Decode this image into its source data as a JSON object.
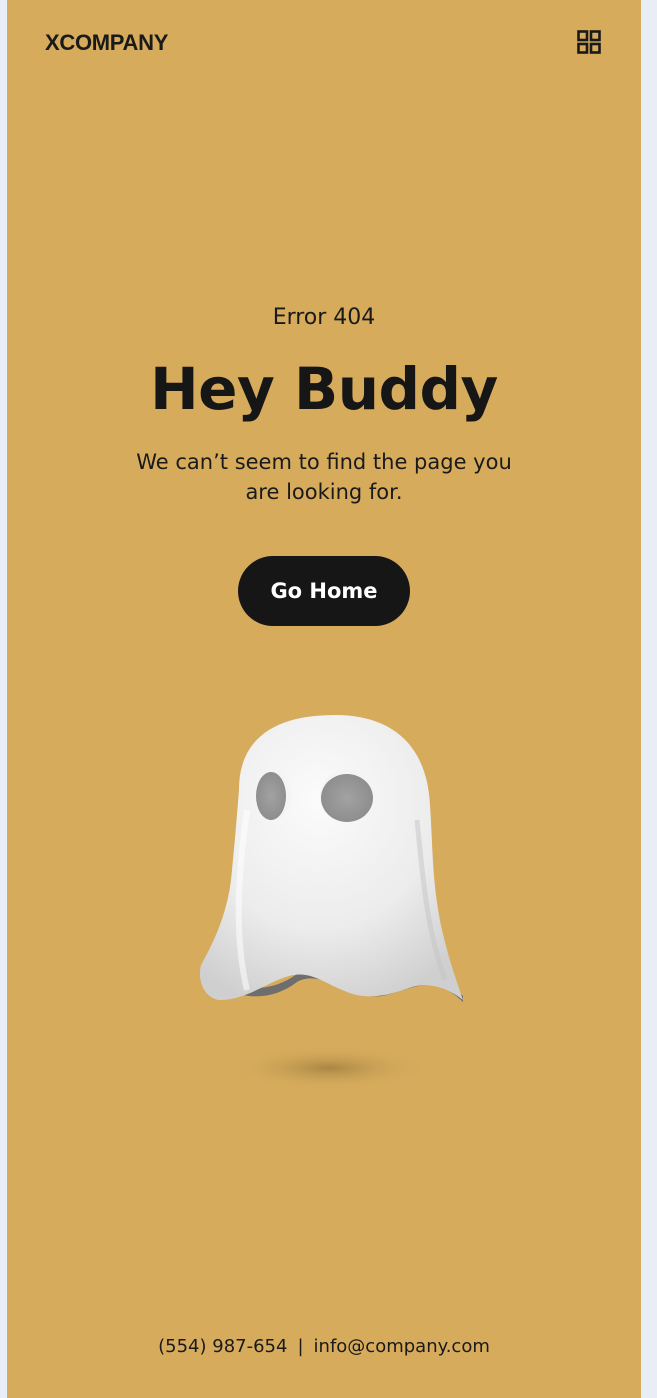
{
  "header": {
    "brand": "XCOMPANY",
    "menu_icon": "grid-menu-icon"
  },
  "hero": {
    "error_code": "Error 404",
    "headline": "Hey Buddy",
    "message": "We can’t seem to find the page you are looking for.",
    "cta_label": "Go Home",
    "illustration": "ghost-illustration"
  },
  "footer": {
    "phone": "(554) 987-654",
    "separator": "|",
    "email": "info@company.com"
  },
  "colors": {
    "background": "#d6ab5c",
    "text": "#1a1a1a",
    "button": "#161616",
    "button_text": "#ffffff"
  }
}
